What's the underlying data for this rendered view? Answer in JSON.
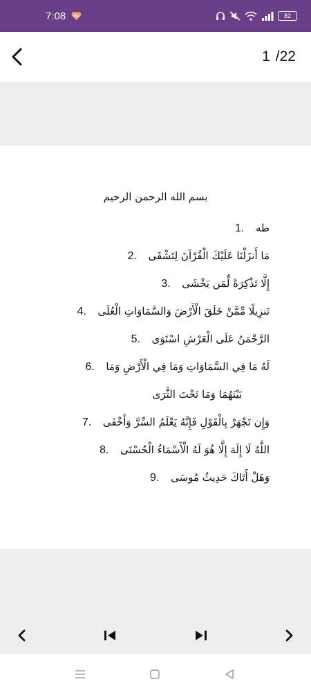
{
  "status_bar": {
    "time": "7:08",
    "battery": "82",
    "icons": [
      "heart-icon",
      "headphones-icon",
      "mute-icon",
      "wifi-icon",
      "signal-icon",
      "battery-icon"
    ],
    "background": "#6a3f8a"
  },
  "header": {
    "back_icon": "chevron-left-icon",
    "current_page": "1",
    "total_pages": "/22"
  },
  "content": {
    "basmala": "بسم الله الرحمن الرحيم",
    "verses": [
      {
        "num": "1.",
        "text": "طه"
      },
      {
        "num": "2.",
        "text": "مَا أَنزَلْنَا عَلَيْكَ الْقُرْآنَ لِتَشْقَى"
      },
      {
        "num": "3.",
        "text": "إِلَّا تَذْكِرَةً لِّمَن يَخْشَى"
      },
      {
        "num": "4.",
        "text": "تَنزِيلًا مِّمَّنْ خَلَقَ الْأَرْضَ وَالسَّمَاوَاتِ الْعُلَى"
      },
      {
        "num": "5.",
        "text": "الرَّحْمَنُ عَلَى الْعَرْشِ اسْتَوَى"
      },
      {
        "num": "6.",
        "text": "لَهُ مَا فِي السَّمَاوَاتِ وَمَا فِي الْأَرْضِ وَمَا",
        "cont": "بَيْنَهُمَا وَمَا تَحْتَ الثَّرَى"
      },
      {
        "num": "7.",
        "text": "وَإِن تَجْهَرْ بِالْقَوْلِ فَإِنَّهُ يَعْلَمُ السِّرَّ وَأَخْفَى"
      },
      {
        "num": "8.",
        "text": "اللَّهُ لَا إِلَهَ إِلَّا هُوَ لَهُ الْأَسْمَاءُ الْحُسْنَى"
      },
      {
        "num": "9.",
        "text": "وَهَلْ أَتَاكَ حَدِيثُ مُوسَى"
      }
    ]
  },
  "controls": {
    "icons": [
      "prev-icon",
      "skip-first-icon",
      "skip-last-icon",
      "next-icon"
    ]
  },
  "navbar": {
    "icons": [
      "menu-icon",
      "home-icon",
      "back-triangle-icon"
    ]
  }
}
